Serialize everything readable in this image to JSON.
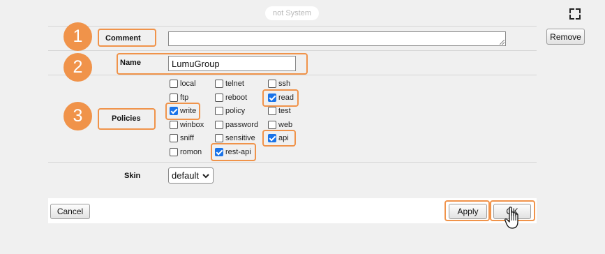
{
  "header": {
    "system_badge": "not System",
    "fullscreen_icon": "fullscreen-icon"
  },
  "side": {
    "remove_label": "Remove"
  },
  "steps": [
    "1",
    "2",
    "3"
  ],
  "form": {
    "comment": {
      "label": "Comment",
      "value": ""
    },
    "name": {
      "label": "Name",
      "value": "LumuGroup"
    },
    "policies": {
      "label": "Policies",
      "items": [
        {
          "label": "local",
          "checked": false
        },
        {
          "label": "telnet",
          "checked": false
        },
        {
          "label": "ssh",
          "checked": false
        },
        {
          "label": "ftp",
          "checked": false
        },
        {
          "label": "reboot",
          "checked": false
        },
        {
          "label": "read",
          "checked": true
        },
        {
          "label": "write",
          "checked": true
        },
        {
          "label": "policy",
          "checked": false
        },
        {
          "label": "test",
          "checked": false
        },
        {
          "label": "winbox",
          "checked": false
        },
        {
          "label": "password",
          "checked": false
        },
        {
          "label": "web",
          "checked": false
        },
        {
          "label": "sniff",
          "checked": false
        },
        {
          "label": "sensitive",
          "checked": false
        },
        {
          "label": "api",
          "checked": true
        },
        {
          "label": "romon",
          "checked": false
        },
        {
          "label": "rest-api",
          "checked": true
        }
      ]
    },
    "skin": {
      "label": "Skin",
      "value": "default"
    }
  },
  "footer": {
    "cancel_label": "Cancel",
    "apply_label": "Apply",
    "ok_label": "OK"
  },
  "colors": {
    "highlight": "#f0934a",
    "checkbox_checked": "#1a73e8"
  }
}
